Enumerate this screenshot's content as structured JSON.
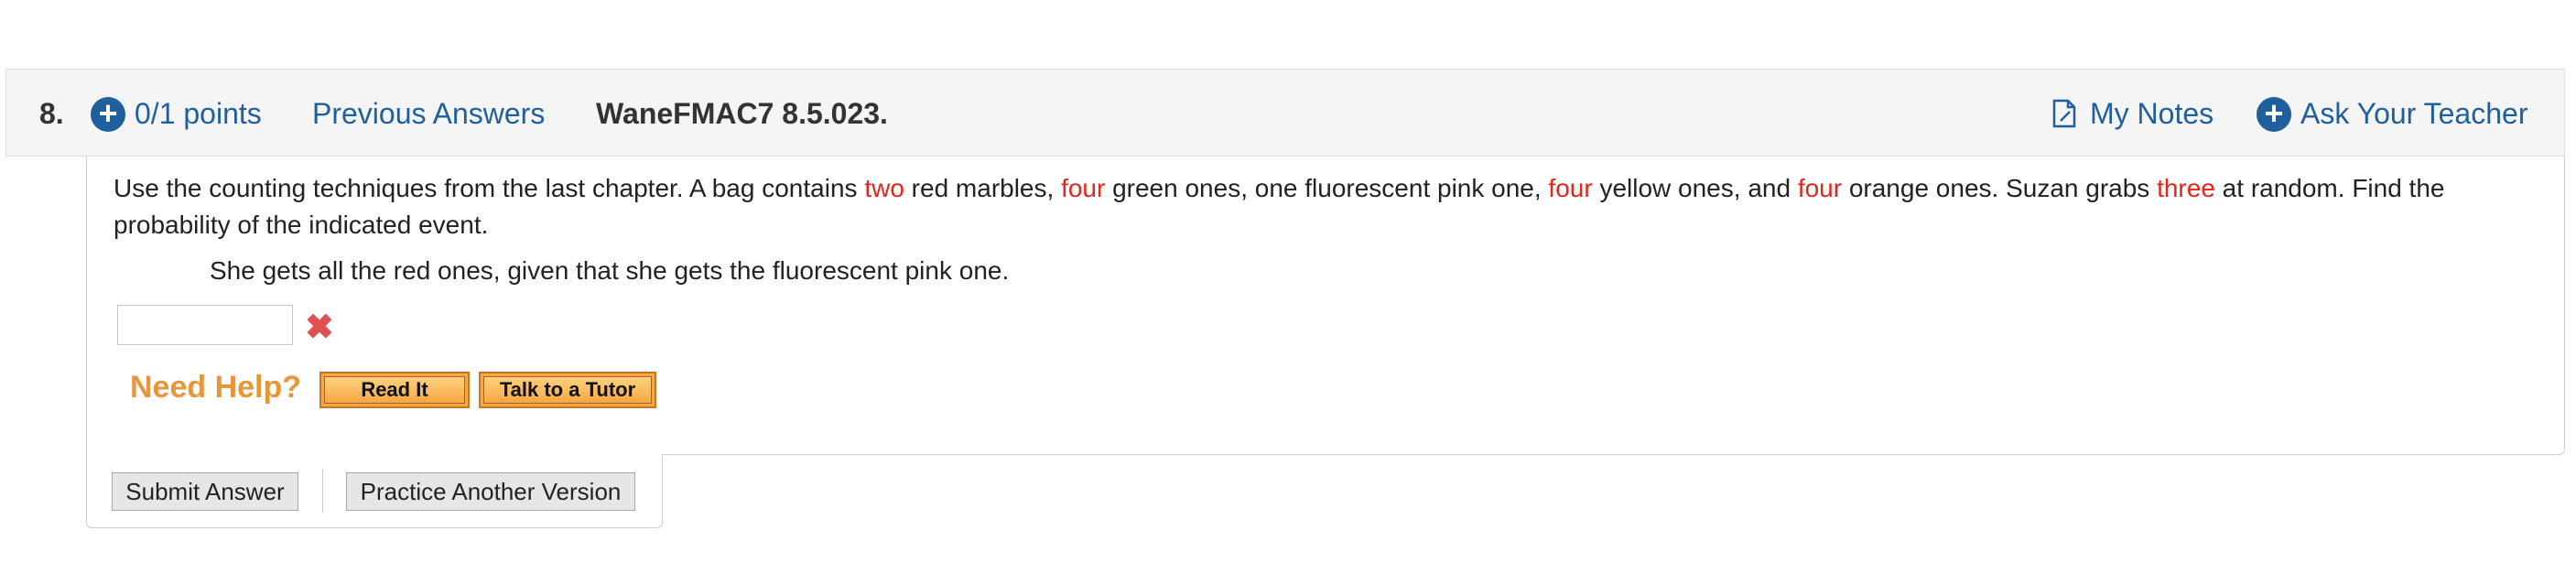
{
  "header": {
    "question_number": "8.",
    "points_label": "0/1 points",
    "previous_answers_label": "Previous Answers",
    "assignment_code": "WaneFMAC7 8.5.023.",
    "my_notes_label": "My Notes",
    "ask_teacher_label": "Ask Your Teacher"
  },
  "question": {
    "parts": [
      {
        "text": "Use the counting techniques from the last chapter. A bag contains ",
        "highlight": false
      },
      {
        "text": "two",
        "highlight": true
      },
      {
        "text": " red marbles, ",
        "highlight": false
      },
      {
        "text": "four",
        "highlight": true
      },
      {
        "text": " green ones, one fluorescent pink one, ",
        "highlight": false
      },
      {
        "text": "four",
        "highlight": true
      },
      {
        "text": " yellow ones, and ",
        "highlight": false
      },
      {
        "text": "four",
        "highlight": true
      },
      {
        "text": " orange ones. Suzan grabs ",
        "highlight": false
      },
      {
        "text": "three",
        "highlight": true
      },
      {
        "text": " at random. Find the probability of the indicated event.",
        "highlight": false
      }
    ],
    "sub_question": "She gets all the red ones, given that she gets the fluorescent pink one.",
    "answer_value": "",
    "answer_status": "incorrect"
  },
  "help": {
    "label": "Need Help?",
    "read_it_label": "Read It",
    "tutor_label": "Talk to a Tutor"
  },
  "actions": {
    "submit_label": "Submit Answer",
    "practice_label": "Practice Another Version"
  },
  "colors": {
    "link_blue": "#1f5f9e",
    "highlight_red": "#e3251b",
    "help_orange": "#e8963a",
    "wrong_mark": "#e05050"
  },
  "icons": {
    "points": "plus-circle-icon",
    "notes": "notes-icon",
    "ask_teacher": "plus-circle-icon",
    "answer_status": "x-mark-icon"
  }
}
